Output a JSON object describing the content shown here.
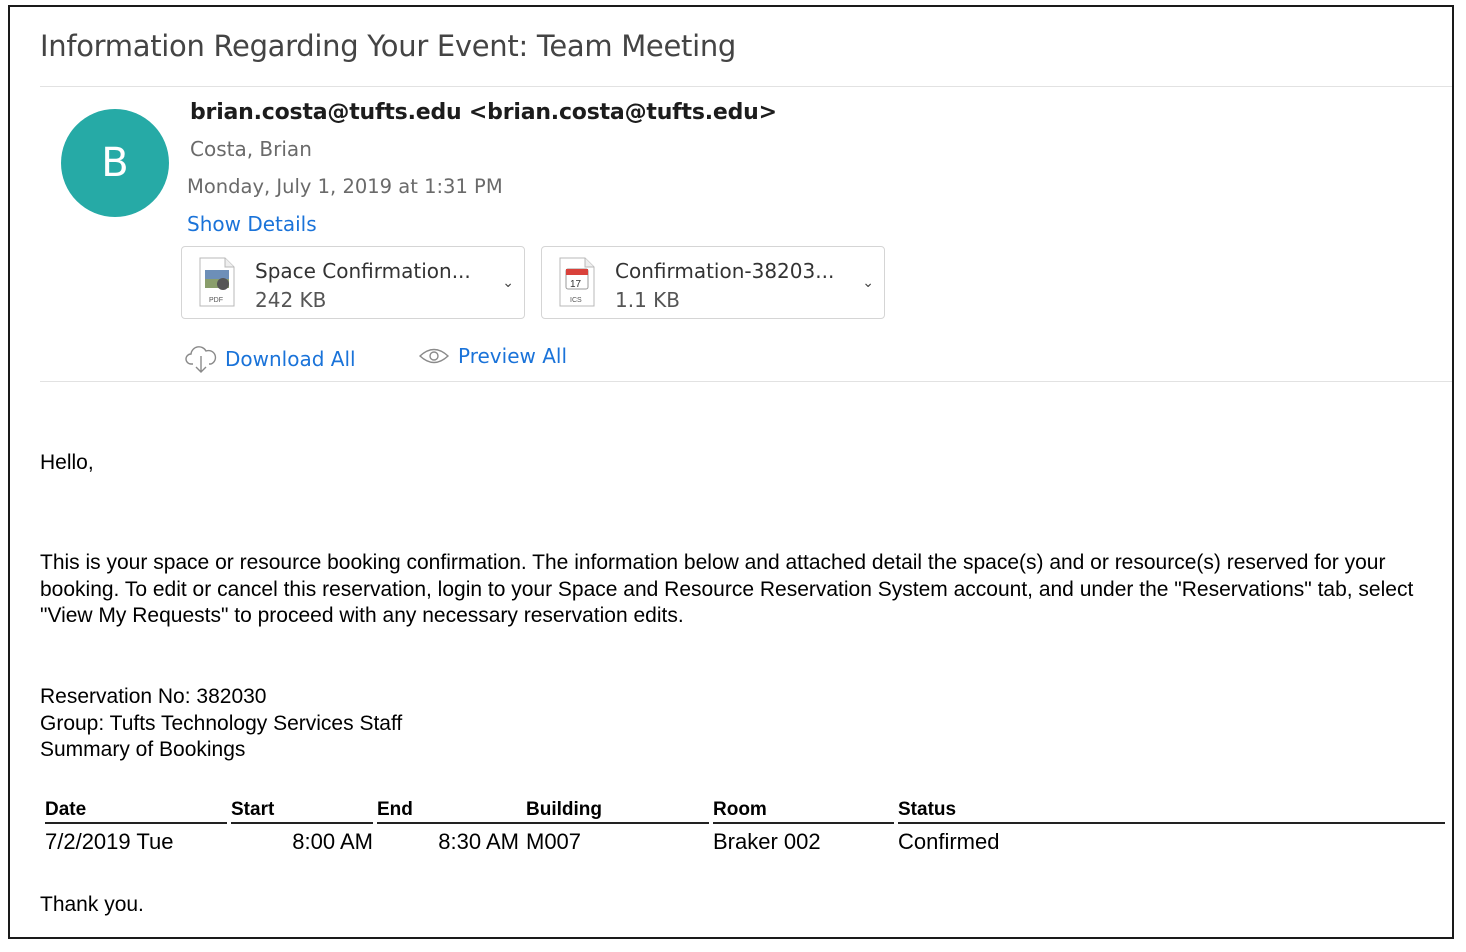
{
  "email": {
    "subject": "Information Regarding Your Event: Team Meeting",
    "avatar_initial": "B",
    "avatar_color": "#26aaa6",
    "from": "brian.costa@tufts.edu <brian.costa@tufts.edu>",
    "to": "Costa, Brian",
    "date": "Monday, July 1, 2019 at 1:31 PM",
    "show_details": "Show Details",
    "attachments": [
      {
        "name": "Space Confirmation...",
        "size": "242 KB",
        "type_label": "PDF",
        "icon": "pdf-file-icon"
      },
      {
        "name": "Confirmation-38203...",
        "size": "1.1 KB",
        "type_label": "ICS",
        "calendar_day": "17",
        "icon": "calendar-file-icon"
      }
    ],
    "download_all": "Download All",
    "preview_all": "Preview All",
    "link_color": "#1a73d9"
  },
  "body": {
    "greeting": "Hello,",
    "paragraph": "This is your space or resource booking confirmation. The information below and attached detail the space(s) and or resource(s) reserved for your booking. To edit or cancel this reservation, login to your Space and Resource Reservation System account, and under the \"Reservations\" tab, select \"View My Requests\" to proceed with any necessary reservation edits.",
    "reservation_no": "Reservation No: 382030",
    "group": "Group: Tufts Technology Services Staff",
    "summary": "Summary of Bookings",
    "table": {
      "headers": {
        "date": "Date",
        "start": "Start",
        "end": "End",
        "building": "Building",
        "room": "Room",
        "status": "Status"
      },
      "rows": [
        {
          "date": "7/2/2019 Tue",
          "start": "8:00 AM",
          "end": "8:30 AM",
          "building": "M007",
          "room": "Braker 002",
          "status": "Confirmed"
        }
      ]
    },
    "thanks": "Thank you."
  }
}
